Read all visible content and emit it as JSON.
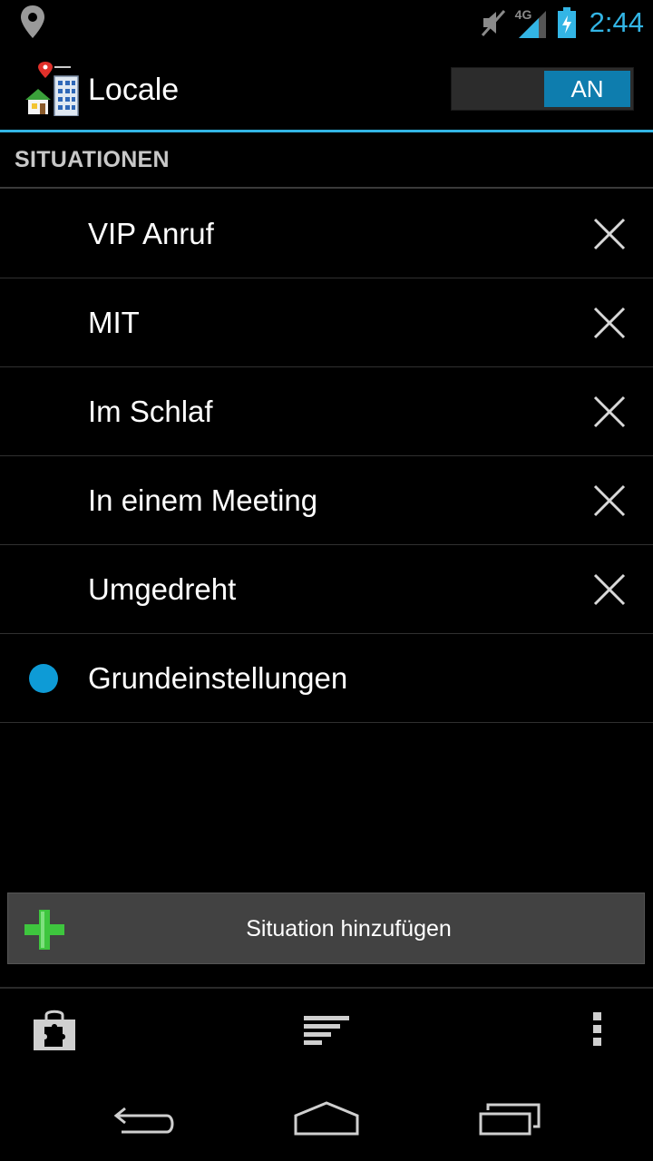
{
  "status_bar": {
    "time": "2:44",
    "network": "4G",
    "icons": [
      "location-icon",
      "mute-icon",
      "signal-icon",
      "battery-charging-icon"
    ]
  },
  "app": {
    "title": "Locale",
    "toggle_label": "AN"
  },
  "section": {
    "title": "SITUATIONEN"
  },
  "situations": [
    {
      "label": "VIP Anruf",
      "deletable": true
    },
    {
      "label": "MIT",
      "deletable": true
    },
    {
      "label": "Im Schlaf",
      "deletable": true
    },
    {
      "label": "In einem Meeting",
      "deletable": true
    },
    {
      "label": "Umgedreht",
      "deletable": true
    },
    {
      "label": "Grundeinstellungen",
      "deletable": false,
      "active": true
    }
  ],
  "add_button": {
    "label": "Situation hinzufügen"
  },
  "bottom_actions": [
    "plugin-store-icon",
    "sort-icon",
    "overflow-menu-icon"
  ],
  "nav": [
    "back-icon",
    "home-icon",
    "recent-apps-icon"
  ],
  "colors": {
    "accent": "#33b5e5",
    "toggle_on": "#0e7dae",
    "active_dot": "#0e9bd6",
    "plus": "#3ec63e"
  }
}
